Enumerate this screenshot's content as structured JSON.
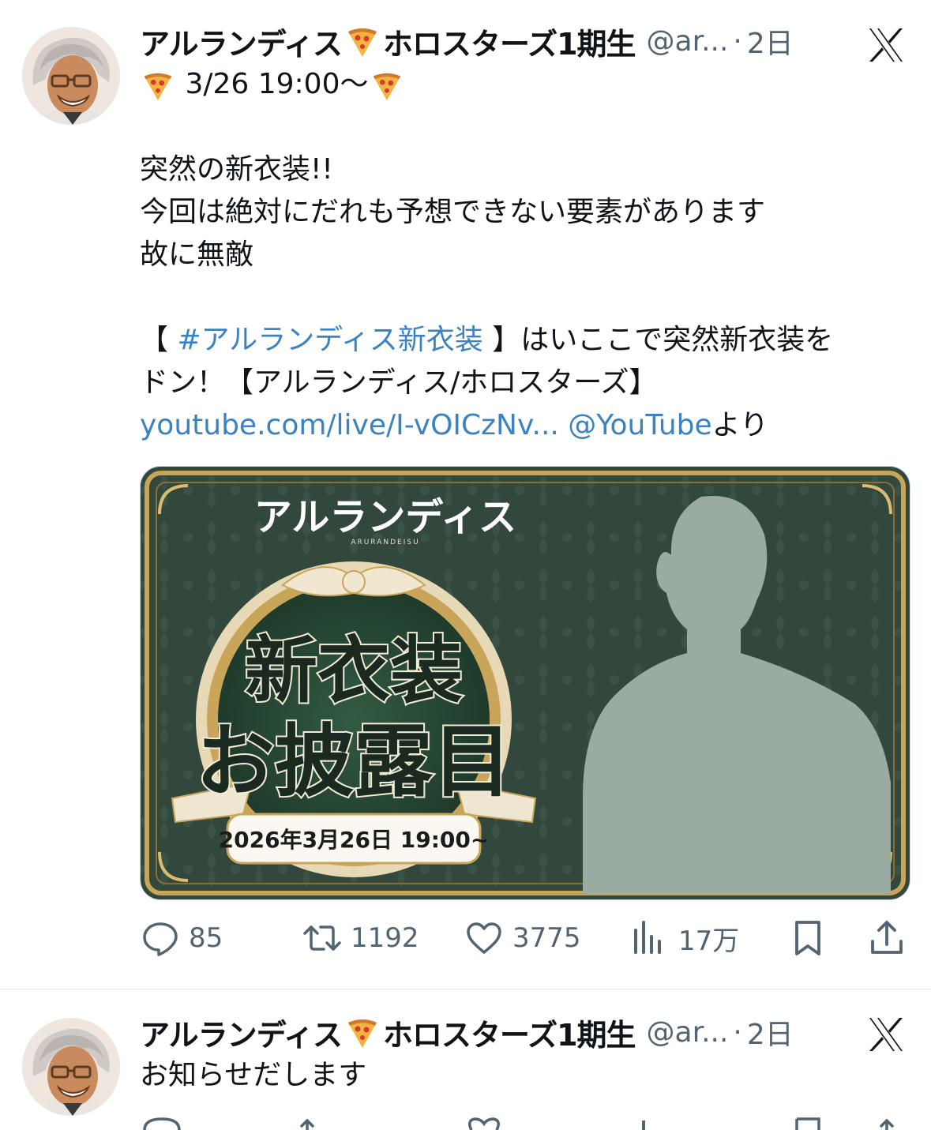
{
  "tweet1": {
    "author_name": "アルランディス",
    "author_suffix": "ホロスターズ1期生",
    "handle": "@ar...",
    "separator": "·",
    "age": "2日",
    "line1": "3/26 19:00〜",
    "line2": "突然の新衣装!!",
    "line3": "今回は絶対にだれも予想できない要素があります",
    "line4": "故に無敵",
    "line5_bracket_open": "【 ",
    "line5_hashtag": "#アルランディス新衣装",
    "line5_rest": " 】はいここで突然新衣装を",
    "line6": "ドン！【アルランディス/ホロスターズ】",
    "line7_url": "youtube.com/live/I-vOICzNv...",
    "line7_mention": " @YouTube",
    "line7_suffix": "より",
    "media": {
      "logo_text": "アルランディス",
      "logo_sub": "ARURANDEISU",
      "title_line1": "新衣装",
      "title_line2": "お披露目",
      "date_text": "2026年3月26日 19:00~"
    },
    "actions": {
      "replies": "85",
      "reposts": "1192",
      "likes": "3775",
      "views": "17万"
    }
  },
  "tweet2": {
    "author_name": "アルランディス",
    "author_suffix": "ホロスターズ1期生",
    "handle": "@ar...",
    "separator": "·",
    "age": "2日",
    "text": "お知らせだします"
  },
  "colors": {
    "link": "#3b82c4",
    "secondary_text": "#536471",
    "media_bg": "#33483d",
    "gold_frame": "#c9a55a"
  },
  "icons": [
    "pizza-icon",
    "x-logo-icon",
    "reply-icon",
    "repost-icon",
    "like-icon",
    "views-icon",
    "bookmark-icon",
    "share-icon"
  ]
}
